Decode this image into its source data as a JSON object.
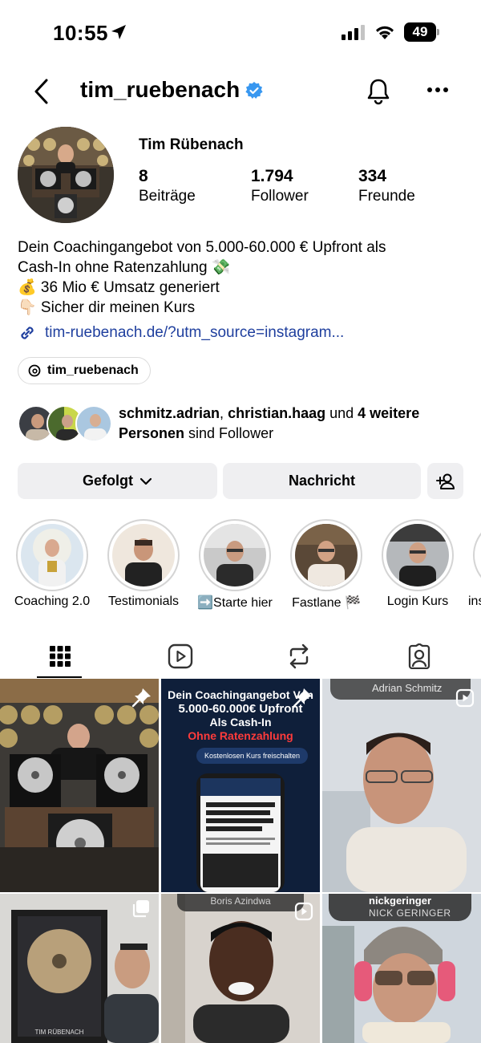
{
  "status_bar": {
    "time": "10:55",
    "battery": "49"
  },
  "header": {
    "username": "tim_ruebenach"
  },
  "profile": {
    "display_name": "Tim Rübenach",
    "stats": [
      {
        "value": "8",
        "label": "Beiträge"
      },
      {
        "value": "1.794",
        "label": "Follower"
      },
      {
        "value": "334",
        "label": "Freunde"
      }
    ],
    "bio_lines": [
      "Dein Coachingangebot von 5.000-60.000 € Upfront als",
      "Cash-In ohne Ratenzahlung 💸",
      "💰 36 Mio € Umsatz generiert",
      "👇🏻 Sicher dir meinen Kurs"
    ],
    "link": "tim-ruebenach.de/?utm_source=instagram...",
    "threads_handle": "tim_ruebenach"
  },
  "followed_by": {
    "user1": "schmitz.adrian",
    "sep": ", ",
    "user2": "christian.haag",
    "and": " und ",
    "more": "4 weitere",
    "persons": "Personen",
    "suffix": " sind Follower"
  },
  "actions": {
    "following": "Gefolgt",
    "message": "Nachricht"
  },
  "highlights": [
    {
      "label": "Coaching 2.0"
    },
    {
      "label": "Testimonials"
    },
    {
      "label": "➡️Starte hier"
    },
    {
      "label": "Fastlane 🏁"
    },
    {
      "label": "Login Kurs"
    },
    {
      "label": "ins"
    }
  ],
  "grid": {
    "post2": {
      "line1": "Dein Coachingangebot Von",
      "line2": "5.000-60.000€ Upfront",
      "line3": "Als Cash-In",
      "line4": "Ohne Ratenzahlung",
      "button": "Kostenlosen Kurs freischalten"
    },
    "post3": {
      "name": "Adrian Schmitz"
    },
    "post4": {
      "plaque": "TIM RÜBENACH"
    },
    "post5": {
      "name": "Boris Azindwa"
    },
    "post6": {
      "handle": "nickgeringer",
      "name": "NICK GERINGER"
    }
  },
  "colors": {
    "link": "#1f3f9e",
    "verified": "#3897f0",
    "button_bg": "#efeff1"
  }
}
